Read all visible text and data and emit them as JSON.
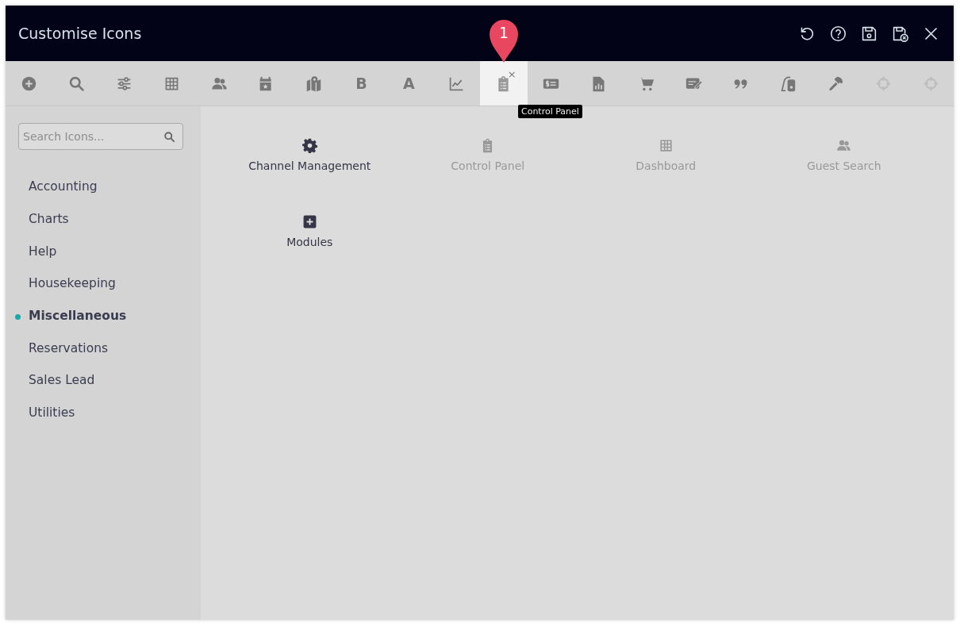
{
  "window": {
    "title": "Customise Icons"
  },
  "header_actions": [
    {
      "kind": "undo"
    },
    {
      "kind": "help"
    },
    {
      "kind": "save"
    },
    {
      "kind": "save-close"
    },
    {
      "kind": "close"
    }
  ],
  "toolbar": [
    {
      "kind": "plus-circle",
      "selected": false,
      "disabled": false
    },
    {
      "kind": "search",
      "selected": false,
      "disabled": false
    },
    {
      "kind": "sliders",
      "selected": false,
      "disabled": false
    },
    {
      "kind": "grid",
      "selected": false,
      "disabled": false
    },
    {
      "kind": "users",
      "selected": false,
      "disabled": false
    },
    {
      "kind": "calendar",
      "selected": false,
      "disabled": false
    },
    {
      "kind": "map",
      "selected": false,
      "disabled": false
    },
    {
      "kind": "glyph",
      "glyph": "B",
      "selected": false,
      "disabled": false
    },
    {
      "kind": "glyph",
      "glyph": "A",
      "selected": false,
      "disabled": false
    },
    {
      "kind": "chart",
      "selected": false,
      "disabled": false
    },
    {
      "kind": "clipboard",
      "selected": true,
      "disabled": false,
      "remove": "×",
      "tooltip": "Control Panel",
      "callout": "1"
    },
    {
      "kind": "money",
      "selected": false,
      "disabled": false
    },
    {
      "kind": "report",
      "selected": false,
      "disabled": false
    },
    {
      "kind": "cart",
      "selected": false,
      "disabled": false
    },
    {
      "kind": "edit",
      "selected": false,
      "disabled": false
    },
    {
      "kind": "quote",
      "selected": false,
      "disabled": false
    },
    {
      "kind": "vacuum",
      "selected": false,
      "disabled": false
    },
    {
      "kind": "hammer",
      "selected": false,
      "disabled": false
    },
    {
      "kind": "crosshair",
      "selected": false,
      "disabled": true
    },
    {
      "kind": "crosshair",
      "selected": false,
      "disabled": true
    }
  ],
  "sidebar": {
    "search": {
      "placeholder": "Search Icons..."
    },
    "items": [
      {
        "label": "Accounting",
        "selected": false
      },
      {
        "label": "Charts",
        "selected": false
      },
      {
        "label": "Help",
        "selected": false
      },
      {
        "label": "Housekeeping",
        "selected": false
      },
      {
        "label": "Miscellaneous",
        "selected": true
      },
      {
        "label": "Reservations",
        "selected": false
      },
      {
        "label": "Sales Lead",
        "selected": false
      },
      {
        "label": "Utilities",
        "selected": false
      }
    ]
  },
  "icons": [
    {
      "label": "Channel Management",
      "kind": "gear",
      "disabled": false
    },
    {
      "label": "Control Panel",
      "kind": "clipboard",
      "disabled": true
    },
    {
      "label": "Dashboard",
      "kind": "grid",
      "disabled": true
    },
    {
      "label": "Guest Search",
      "kind": "users",
      "disabled": true
    },
    {
      "label": "Modules",
      "kind": "plus-square",
      "disabled": false
    }
  ]
}
